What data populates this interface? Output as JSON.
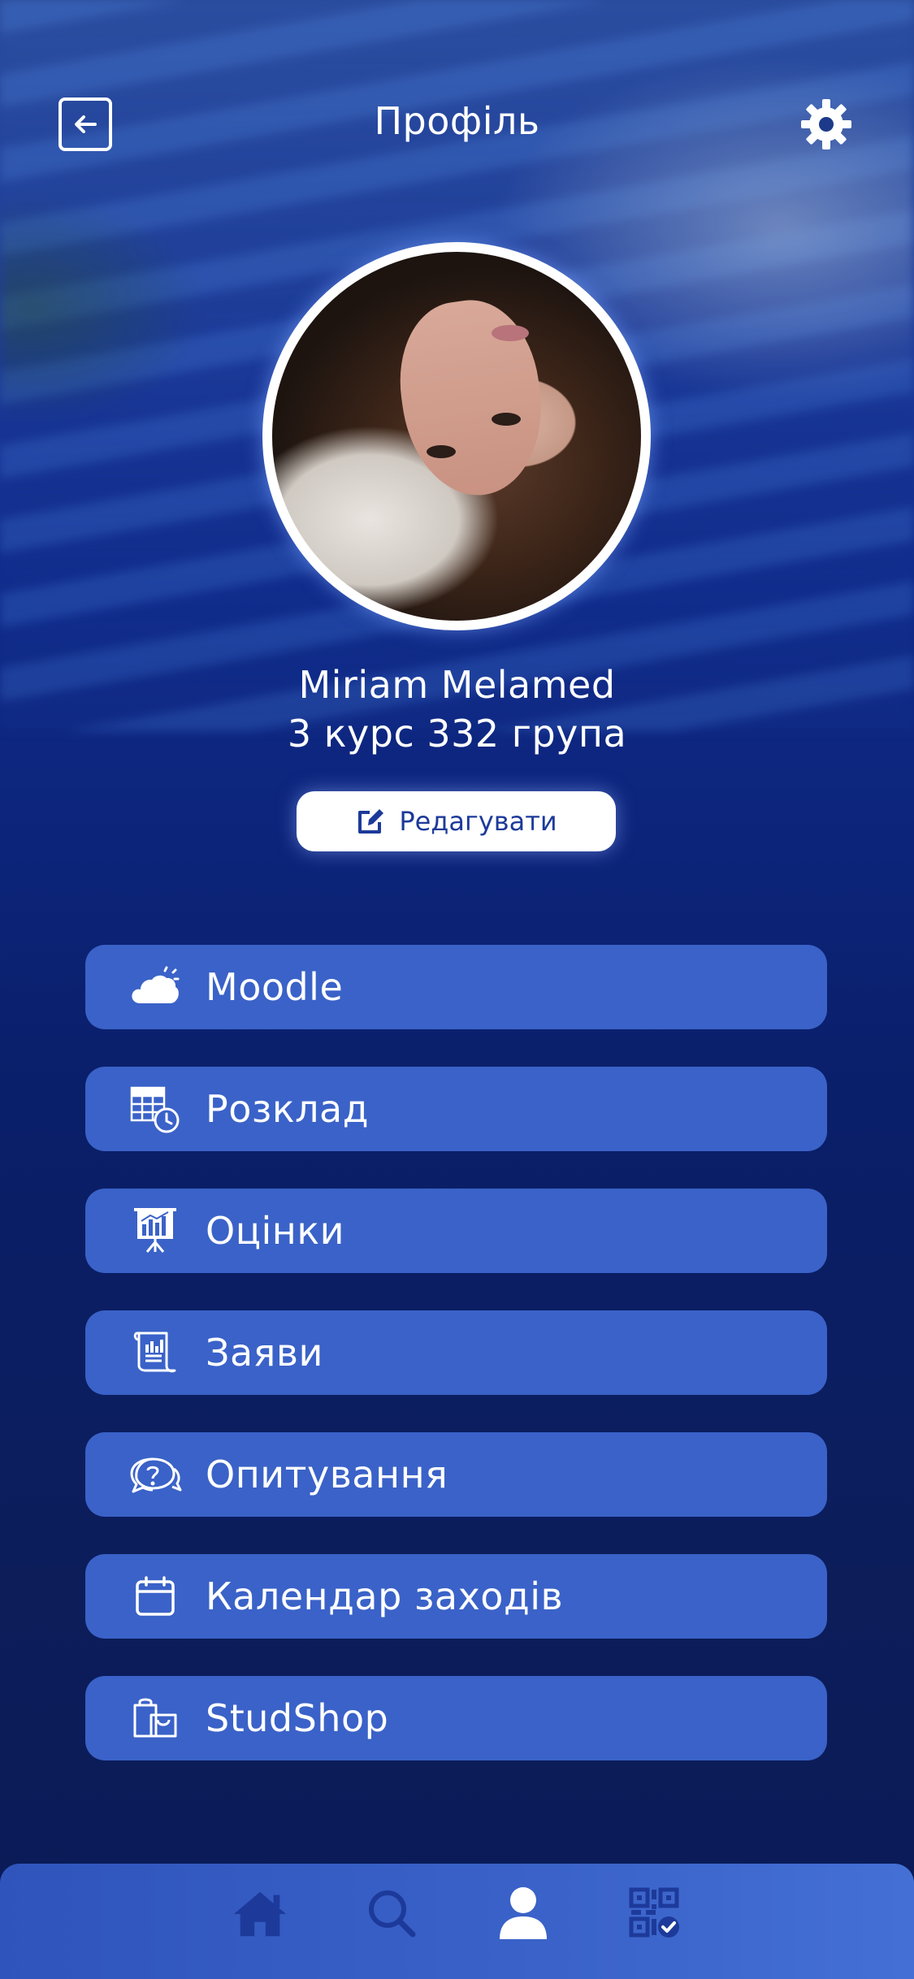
{
  "header": {
    "title": "Профіль",
    "back_icon": "back-arrow-icon",
    "settings_icon": "gear-icon"
  },
  "profile": {
    "name": "Miriam Melamed",
    "group": "3 курс 332 група",
    "edit_label": "Редагувати",
    "edit_icon": "edit-icon"
  },
  "menu": {
    "items": [
      {
        "label": "Moodle",
        "icon": "cloud-icon"
      },
      {
        "label": "Розклад",
        "icon": "schedule-icon"
      },
      {
        "label": "Оцінки",
        "icon": "grades-chart-icon"
      },
      {
        "label": "Заяви",
        "icon": "document-icon"
      },
      {
        "label": "Опитування",
        "icon": "survey-chat-icon"
      },
      {
        "label": "Календар заходів",
        "icon": "calendar-icon"
      },
      {
        "label": "StudShop",
        "icon": "shopping-bag-icon"
      }
    ]
  },
  "bottom_nav": {
    "items": [
      "home-icon",
      "search-icon",
      "profile-icon",
      "qr-code-icon"
    ],
    "active": "profile-icon"
  },
  "colors": {
    "accent": "#3a62c8",
    "nav_icon": "#1d3a9a",
    "active_icon": "#ffffff"
  }
}
